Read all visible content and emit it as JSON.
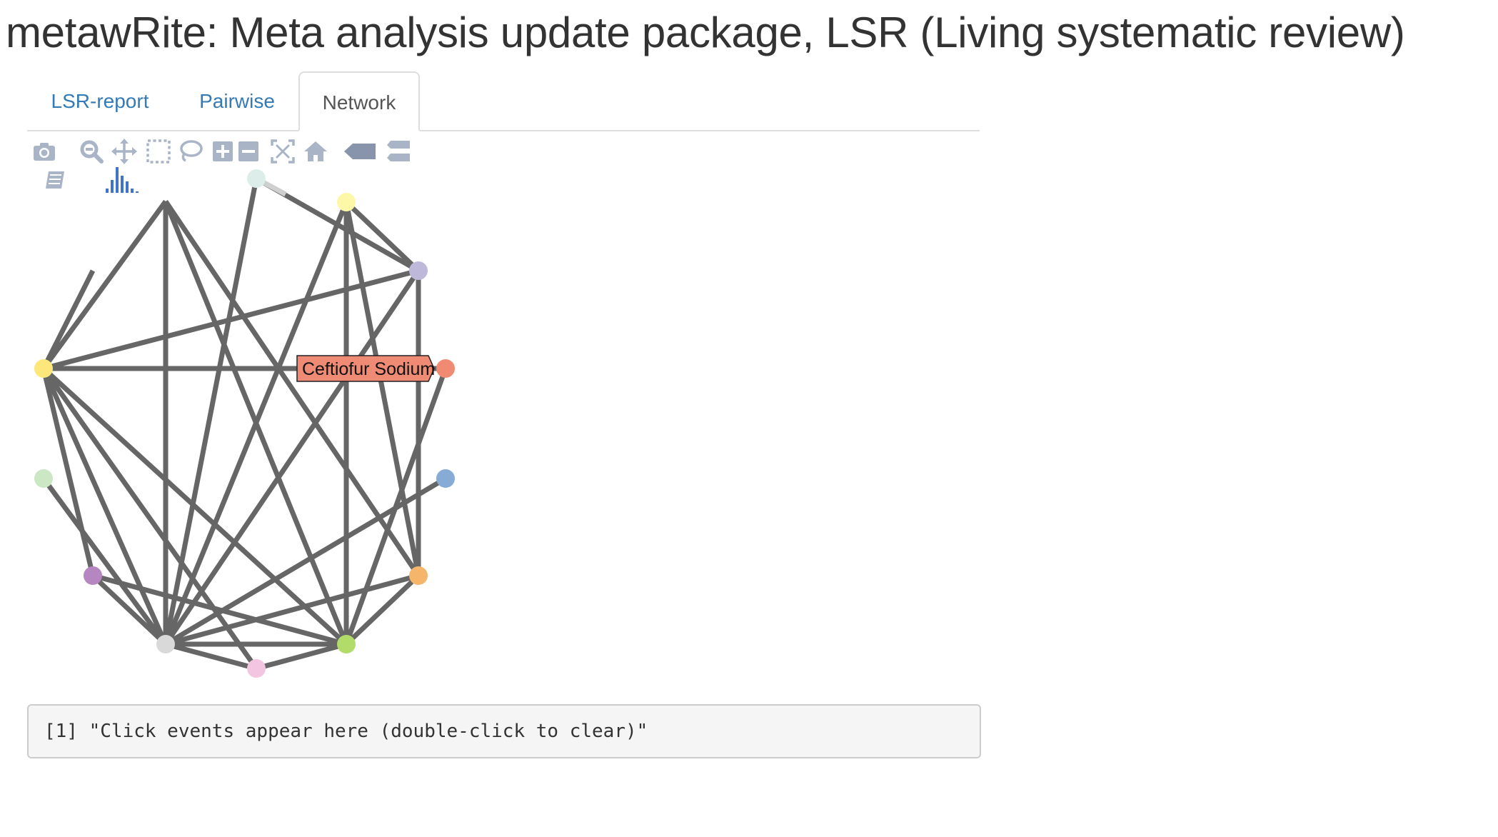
{
  "page": {
    "title": "metawRite: Meta analysis update package, LSR (Living systematic review)"
  },
  "tabs": [
    {
      "label": "LSR-report",
      "active": false
    },
    {
      "label": "Pairwise",
      "active": false
    },
    {
      "label": "Network",
      "active": true
    }
  ],
  "modebar": {
    "buttons": [
      {
        "name": "camera-icon",
        "title": "Download plot as a png"
      },
      {
        "name": "zoom-icon",
        "title": "Zoom"
      },
      {
        "name": "pan-icon",
        "title": "Pan"
      },
      {
        "name": "box-select-icon",
        "title": "Box Select"
      },
      {
        "name": "lasso-select-icon",
        "title": "Lasso Select"
      },
      {
        "name": "zoom-in-icon",
        "title": "Zoom in"
      },
      {
        "name": "zoom-out-icon",
        "title": "Zoom out"
      },
      {
        "name": "autoscale-icon",
        "title": "Autoscale"
      },
      {
        "name": "reset-axes-icon",
        "title": "Reset axes"
      },
      {
        "name": "hover-closest-icon",
        "title": "Show closest data on hover"
      },
      {
        "name": "hover-compare-icon",
        "title": "Compare data on hover"
      },
      {
        "name": "edit-chart-icon",
        "title": "Edit in Chart Studio"
      },
      {
        "name": "plotly-logo-icon",
        "title": "Produced with Plotly"
      }
    ]
  },
  "network": {
    "edge_color": "#666666",
    "hover_label": {
      "text": "Ceftiofur Sodium",
      "color": "#ef8a74"
    },
    "nodes": [
      {
        "id": 0,
        "color": "#ddeeea"
      },
      {
        "id": 1,
        "color": "#fdf8a8"
      },
      {
        "id": 2,
        "color": "#beb9db"
      },
      {
        "id": 3,
        "color": "#f08a72"
      },
      {
        "id": 4,
        "color": "#86acd5"
      },
      {
        "id": 5,
        "color": "#f5b56a"
      },
      {
        "id": 6,
        "color": "#b2dc6a"
      },
      {
        "id": 7,
        "color": "#f3c5e1"
      },
      {
        "id": 8,
        "color": "#d9d9d9"
      },
      {
        "id": 9,
        "color": "#b686c1"
      },
      {
        "id": 10,
        "color": "#cbe7c3"
      },
      {
        "id": 11,
        "color": "#fde67a"
      }
    ],
    "edges": [
      [
        11,
        8
      ],
      [
        11,
        6
      ],
      [
        11,
        7
      ],
      [
        11,
        9
      ],
      [
        11,
        3
      ],
      [
        11,
        2
      ],
      [
        8,
        6
      ],
      [
        8,
        7
      ],
      [
        8,
        9
      ],
      [
        8,
        10
      ],
      [
        8,
        1
      ],
      [
        8,
        2
      ],
      [
        8,
        0
      ],
      [
        8,
        5
      ],
      [
        8,
        4
      ],
      [
        6,
        7
      ],
      [
        6,
        5
      ],
      [
        6,
        3
      ],
      [
        6,
        1
      ],
      [
        6,
        9
      ],
      [
        5,
        2
      ],
      [
        5,
        1
      ],
      [
        1,
        2
      ],
      [
        0,
        2
      ]
    ]
  },
  "console": {
    "output": "[1] \"Click events appear here (double-click to clear)\""
  }
}
